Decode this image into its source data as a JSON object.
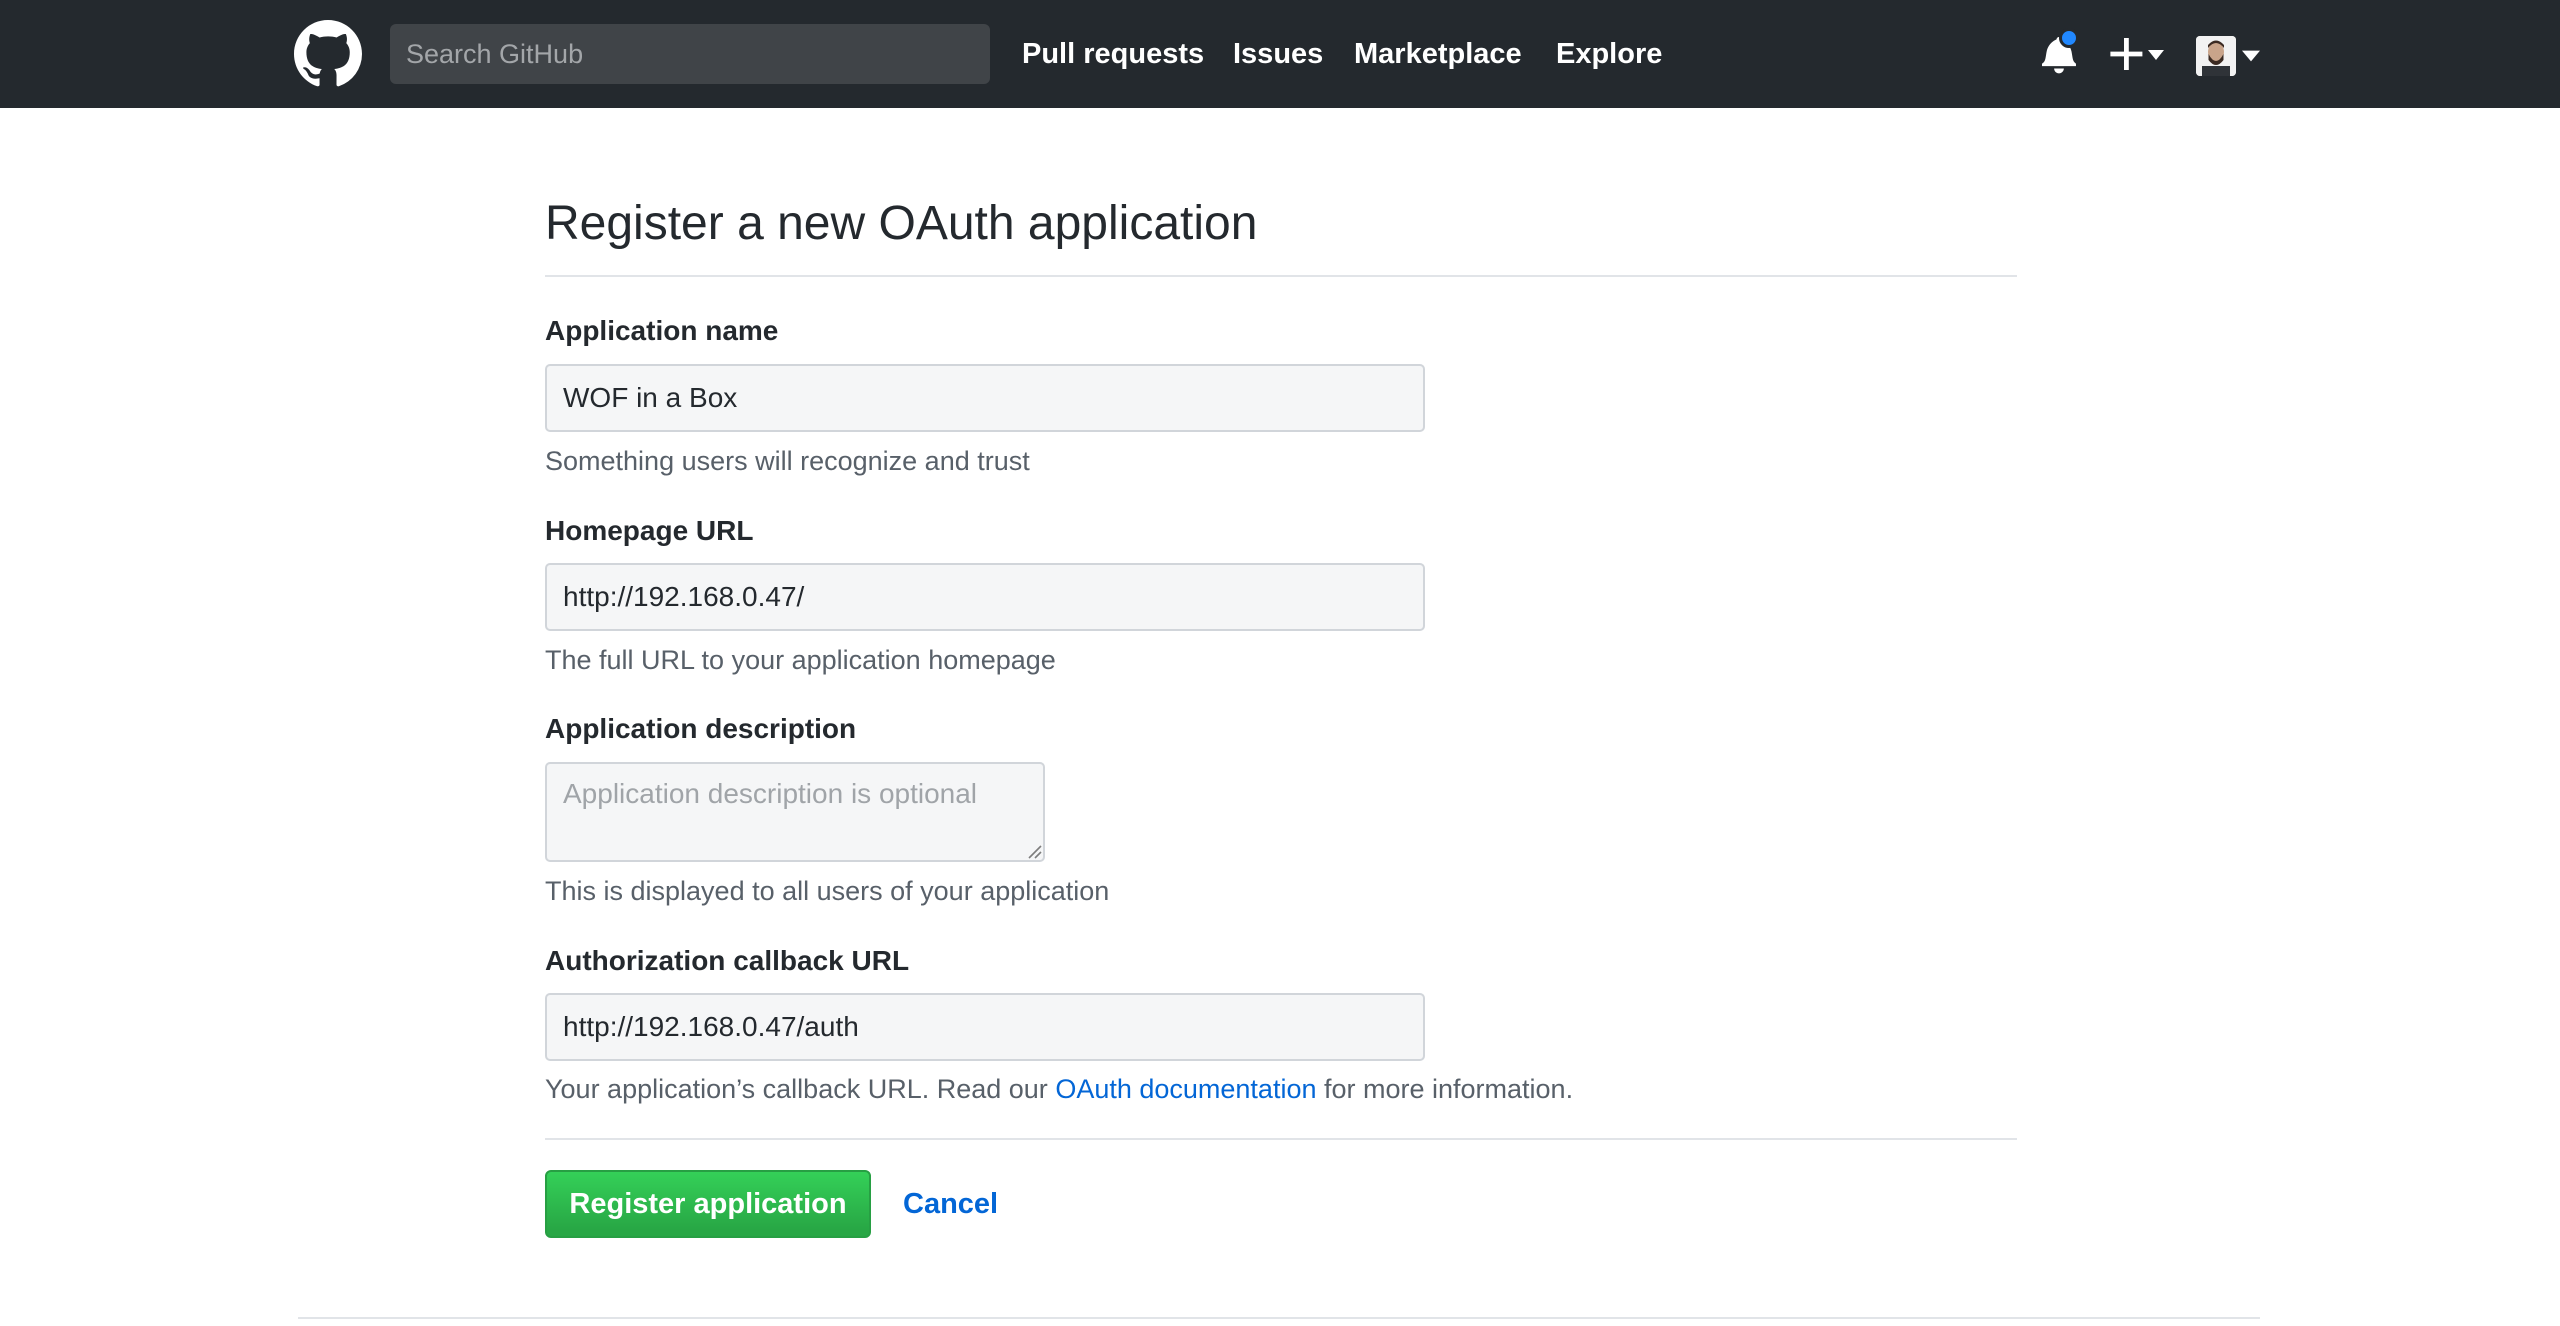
{
  "header": {
    "logo_icon": "github-mark-icon",
    "search_placeholder": "Search GitHub",
    "nav": [
      {
        "label": "Pull requests"
      },
      {
        "label": "Issues"
      },
      {
        "label": "Marketplace"
      },
      {
        "label": "Explore"
      }
    ],
    "notifications_icon": "bell-icon",
    "notification_dot_color": "#2188ff",
    "create_icon": "plus-icon",
    "avatar_icon": "user-avatar"
  },
  "form": {
    "title": "Register a new OAuth application",
    "app_name": {
      "label": "Application name",
      "value": "WOF in a Box",
      "note": "Something users will recognize and trust"
    },
    "homepage": {
      "label": "Homepage URL",
      "value": "http://192.168.0.47/",
      "note": "The full URL to your application homepage"
    },
    "description": {
      "label": "Application description",
      "placeholder": "Application description is optional",
      "note": "This is displayed to all users of your application"
    },
    "callback": {
      "label": "Authorization callback URL",
      "value": "http://192.168.0.47/auth",
      "note_before": "Your application’s callback URL. Read our ",
      "note_link": "OAuth documentation",
      "note_after": " for more information."
    },
    "submit_label": "Register application",
    "cancel_label": "Cancel"
  },
  "colors": {
    "header_bg": "#24292e",
    "primary_button": "#28a745",
    "link": "#0366d6"
  }
}
